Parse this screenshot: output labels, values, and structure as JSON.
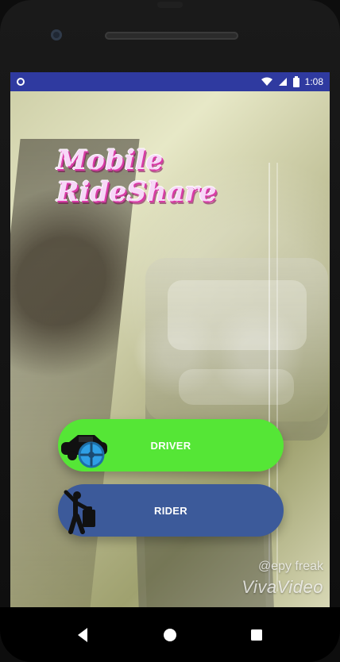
{
  "status_bar": {
    "time": "1:08"
  },
  "app": {
    "title": "Mobile RideShare",
    "buttons": {
      "driver_label": "DRIVER",
      "rider_label": "RIDER"
    },
    "watermark": {
      "line1": "@epy freak",
      "line2": "VivaVideo"
    }
  },
  "icons": {
    "status_left": "status-dot-icon",
    "wifi": "wifi-icon",
    "signal": "signal-icon",
    "battery": "battery-icon",
    "driver": "driver-car-wheel-icon",
    "rider": "rider-luggage-icon",
    "nav_back": "back-icon",
    "nav_home": "home-icon",
    "nav_recent": "recent-apps-icon"
  },
  "colors": {
    "status_bar": "#2f3aa0",
    "driver_button": "#55e636",
    "rider_button": "#3c5a9a",
    "title_fill": "#f7d7f8",
    "title_shadow": "#d93aa6"
  }
}
